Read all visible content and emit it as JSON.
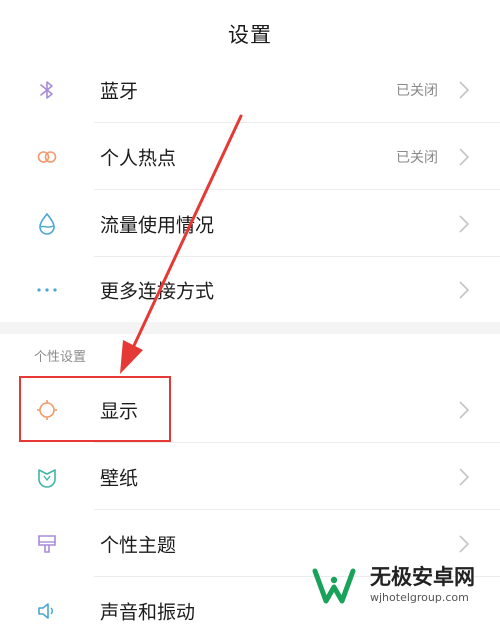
{
  "header": {
    "title": "设置"
  },
  "rows_top": [
    {
      "label": "蓝牙",
      "status": "已关闭",
      "icon": "bluetooth-icon"
    },
    {
      "label": "个人热点",
      "status": "已关闭",
      "icon": "hotspot-icon"
    },
    {
      "label": "流量使用情况",
      "status": "",
      "icon": "data-usage-icon"
    },
    {
      "label": "更多连接方式",
      "status": "",
      "icon": "more-dots-icon"
    }
  ],
  "section": {
    "title": "个性设置"
  },
  "rows_personal": [
    {
      "label": "显示",
      "icon": "display-brightness-icon"
    },
    {
      "label": "壁纸",
      "icon": "wallpaper-icon"
    },
    {
      "label": "个性主题",
      "icon": "theme-brush-icon"
    },
    {
      "label": "声音和振动",
      "icon": "sound-icon"
    }
  ],
  "watermark": {
    "name": "无极安卓网",
    "url": "wjhotelgroup.com"
  },
  "colors": {
    "bluetooth": "#a78bd8",
    "hotspot": "#f29a6b",
    "data": "#4aa6d6",
    "more": "#4aa6d6",
    "display": "#f29a6b",
    "wallpaper": "#3fb6a6",
    "theme": "#a78bd8",
    "highlight": "#e53935",
    "logo_green": "#19a35a"
  }
}
